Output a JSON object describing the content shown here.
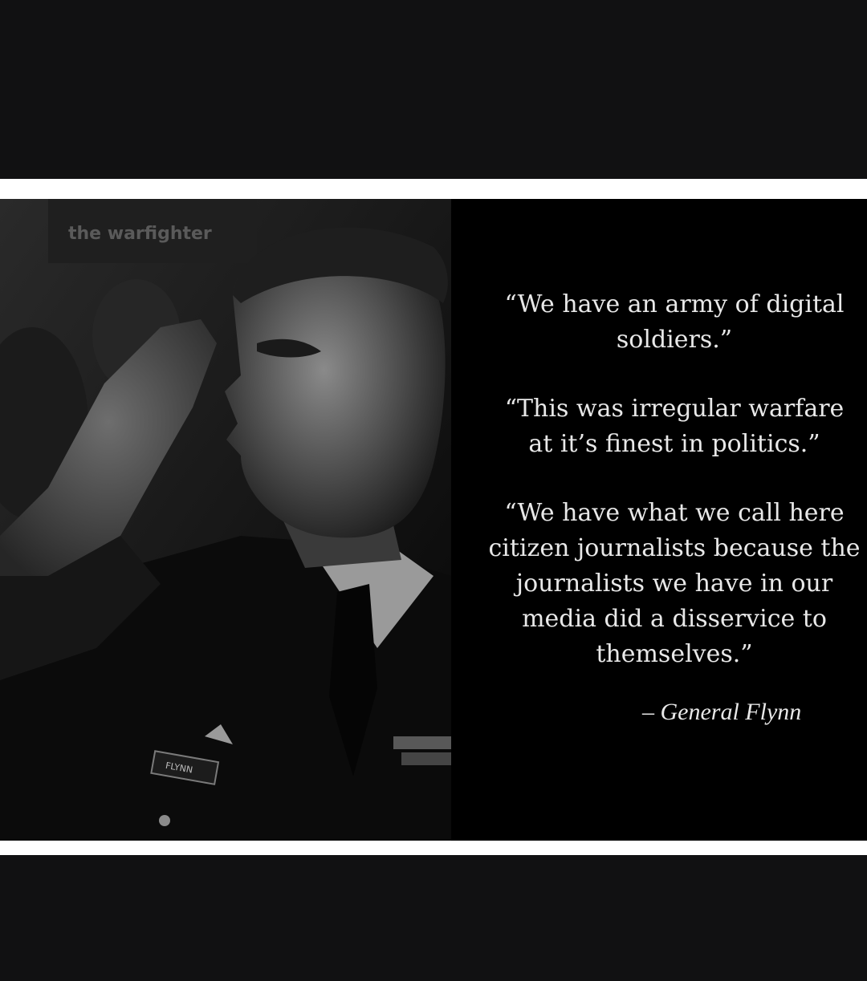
{
  "quotes": [
    "“We have an army of digital\nsoldiers.”",
    "“This was irregular warfare\nat it’s finest in politics.”",
    "“We have what we call here\ncitizen journalists because the\njournalists we have in our\nmedia did a disservice to\nthemselves.”"
  ],
  "attribution": "– General Flynn",
  "photo": {
    "banner_text": "the warfighter",
    "nametag": "FLYNN"
  },
  "colors": {
    "background": "#111112",
    "frame": "#ffffff",
    "panel": "#000000",
    "text": "#e8e8e8"
  }
}
